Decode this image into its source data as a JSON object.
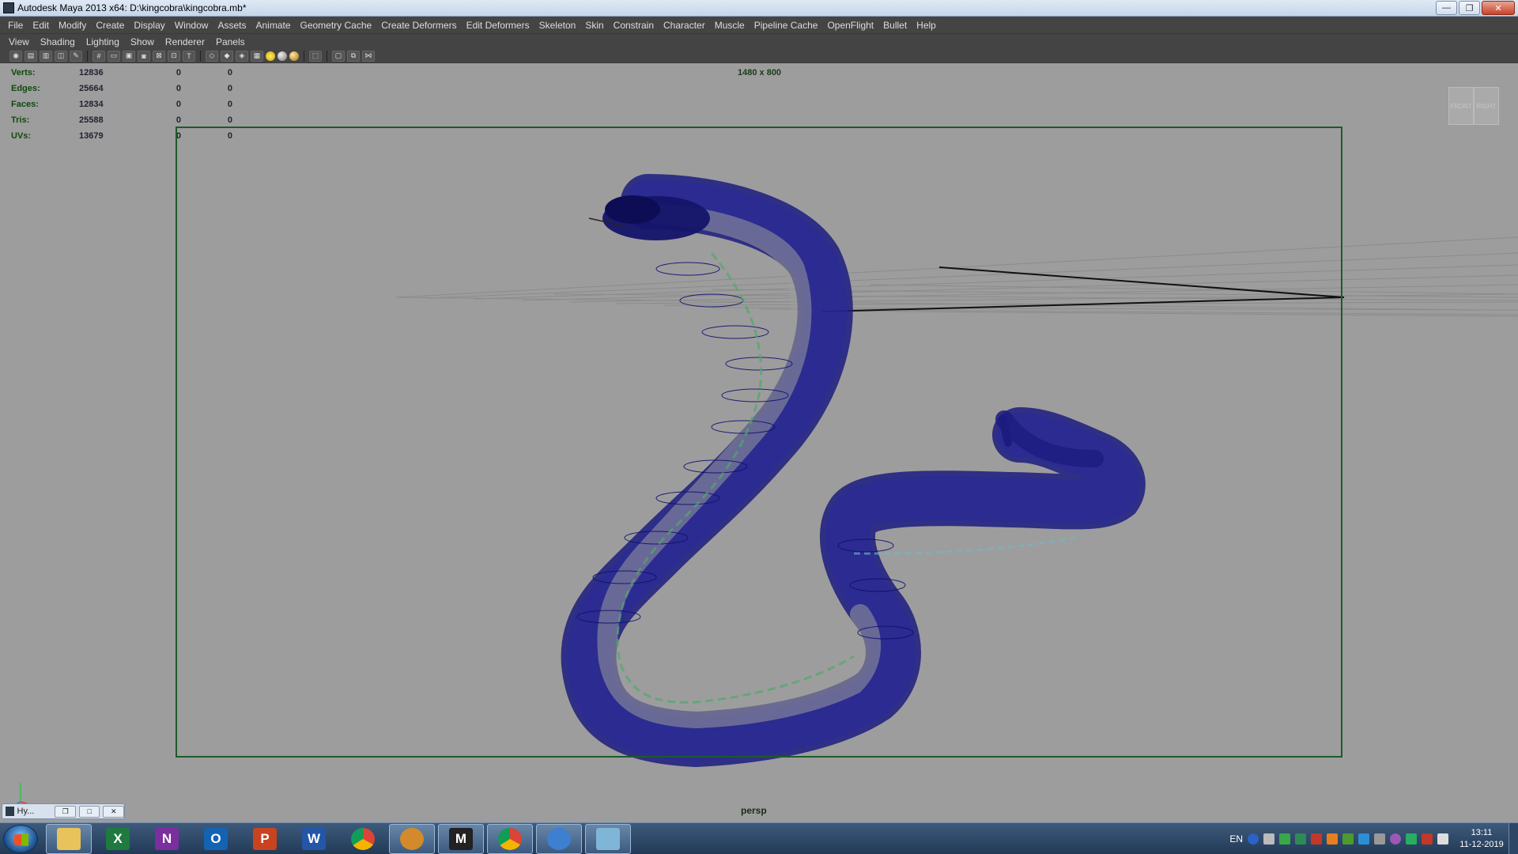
{
  "window": {
    "title": "Autodesk Maya 2013 x64: D:\\kingcobra\\kingcobra.mb*",
    "minimize": "—",
    "maximize": "❐",
    "close": "✕"
  },
  "menubar": [
    "File",
    "Edit",
    "Modify",
    "Create",
    "Display",
    "Window",
    "Assets",
    "Animate",
    "Geometry Cache",
    "Create Deformers",
    "Edit Deformers",
    "Skeleton",
    "Skin",
    "Constrain",
    "Character",
    "Muscle",
    "Pipeline Cache",
    "OpenFlight",
    "Bullet",
    "Help"
  ],
  "panel_menu": [
    "View",
    "Shading",
    "Lighting",
    "Show",
    "Renderer",
    "Panels"
  ],
  "hud": {
    "rows": [
      {
        "label": "Verts:",
        "v1": "12836",
        "v2": "0",
        "v3": "0"
      },
      {
        "label": "Edges:",
        "v1": "25664",
        "v2": "0",
        "v3": "0"
      },
      {
        "label": "Faces:",
        "v1": "12834",
        "v2": "0",
        "v3": "0"
      },
      {
        "label": "Tris:",
        "v1": "25588",
        "v2": "0",
        "v3": "0"
      },
      {
        "label": "UVs:",
        "v1": "13679",
        "v2": "0",
        "v3": "0"
      }
    ],
    "resolution": "1480 x 800",
    "camera": "persp"
  },
  "viewcube": {
    "front": "FRONT",
    "right": "RIGHT"
  },
  "axis": {
    "x": "x",
    "y": "y",
    "z": "z"
  },
  "minimized_window": {
    "label": "Hy..."
  },
  "taskbar": {
    "apps": [
      {
        "name": "file-explorer",
        "glyph": "",
        "color": "#e8c25a"
      },
      {
        "name": "excel",
        "glyph": "X",
        "color": "#1f7a3f"
      },
      {
        "name": "onenote",
        "glyph": "N",
        "color": "#7b2f9e"
      },
      {
        "name": "outlook",
        "glyph": "O",
        "color": "#1463b3"
      },
      {
        "name": "powerpoint",
        "glyph": "P",
        "color": "#c8431f"
      },
      {
        "name": "word",
        "glyph": "W",
        "color": "#2456a8"
      },
      {
        "name": "chrome",
        "glyph": "",
        "color": "#4caf50"
      },
      {
        "name": "paint-app",
        "glyph": "",
        "color": "#d38a2b"
      },
      {
        "name": "maya",
        "glyph": "M",
        "color": "#222222"
      },
      {
        "name": "chrome-2",
        "glyph": "",
        "color": "#4caf50"
      },
      {
        "name": "vpn-shield",
        "glyph": "",
        "color": "#3d7fd0"
      },
      {
        "name": "notepad",
        "glyph": "",
        "color": "#7fb6d8"
      }
    ],
    "language": "EN",
    "time": "13:11",
    "date": "11-12-2019"
  },
  "colors": {
    "viewport_bg": "#9d9d9d",
    "wire": "#1a1a7a",
    "gate": "#1e5a2c",
    "hud_text": "#0e4a0e"
  }
}
